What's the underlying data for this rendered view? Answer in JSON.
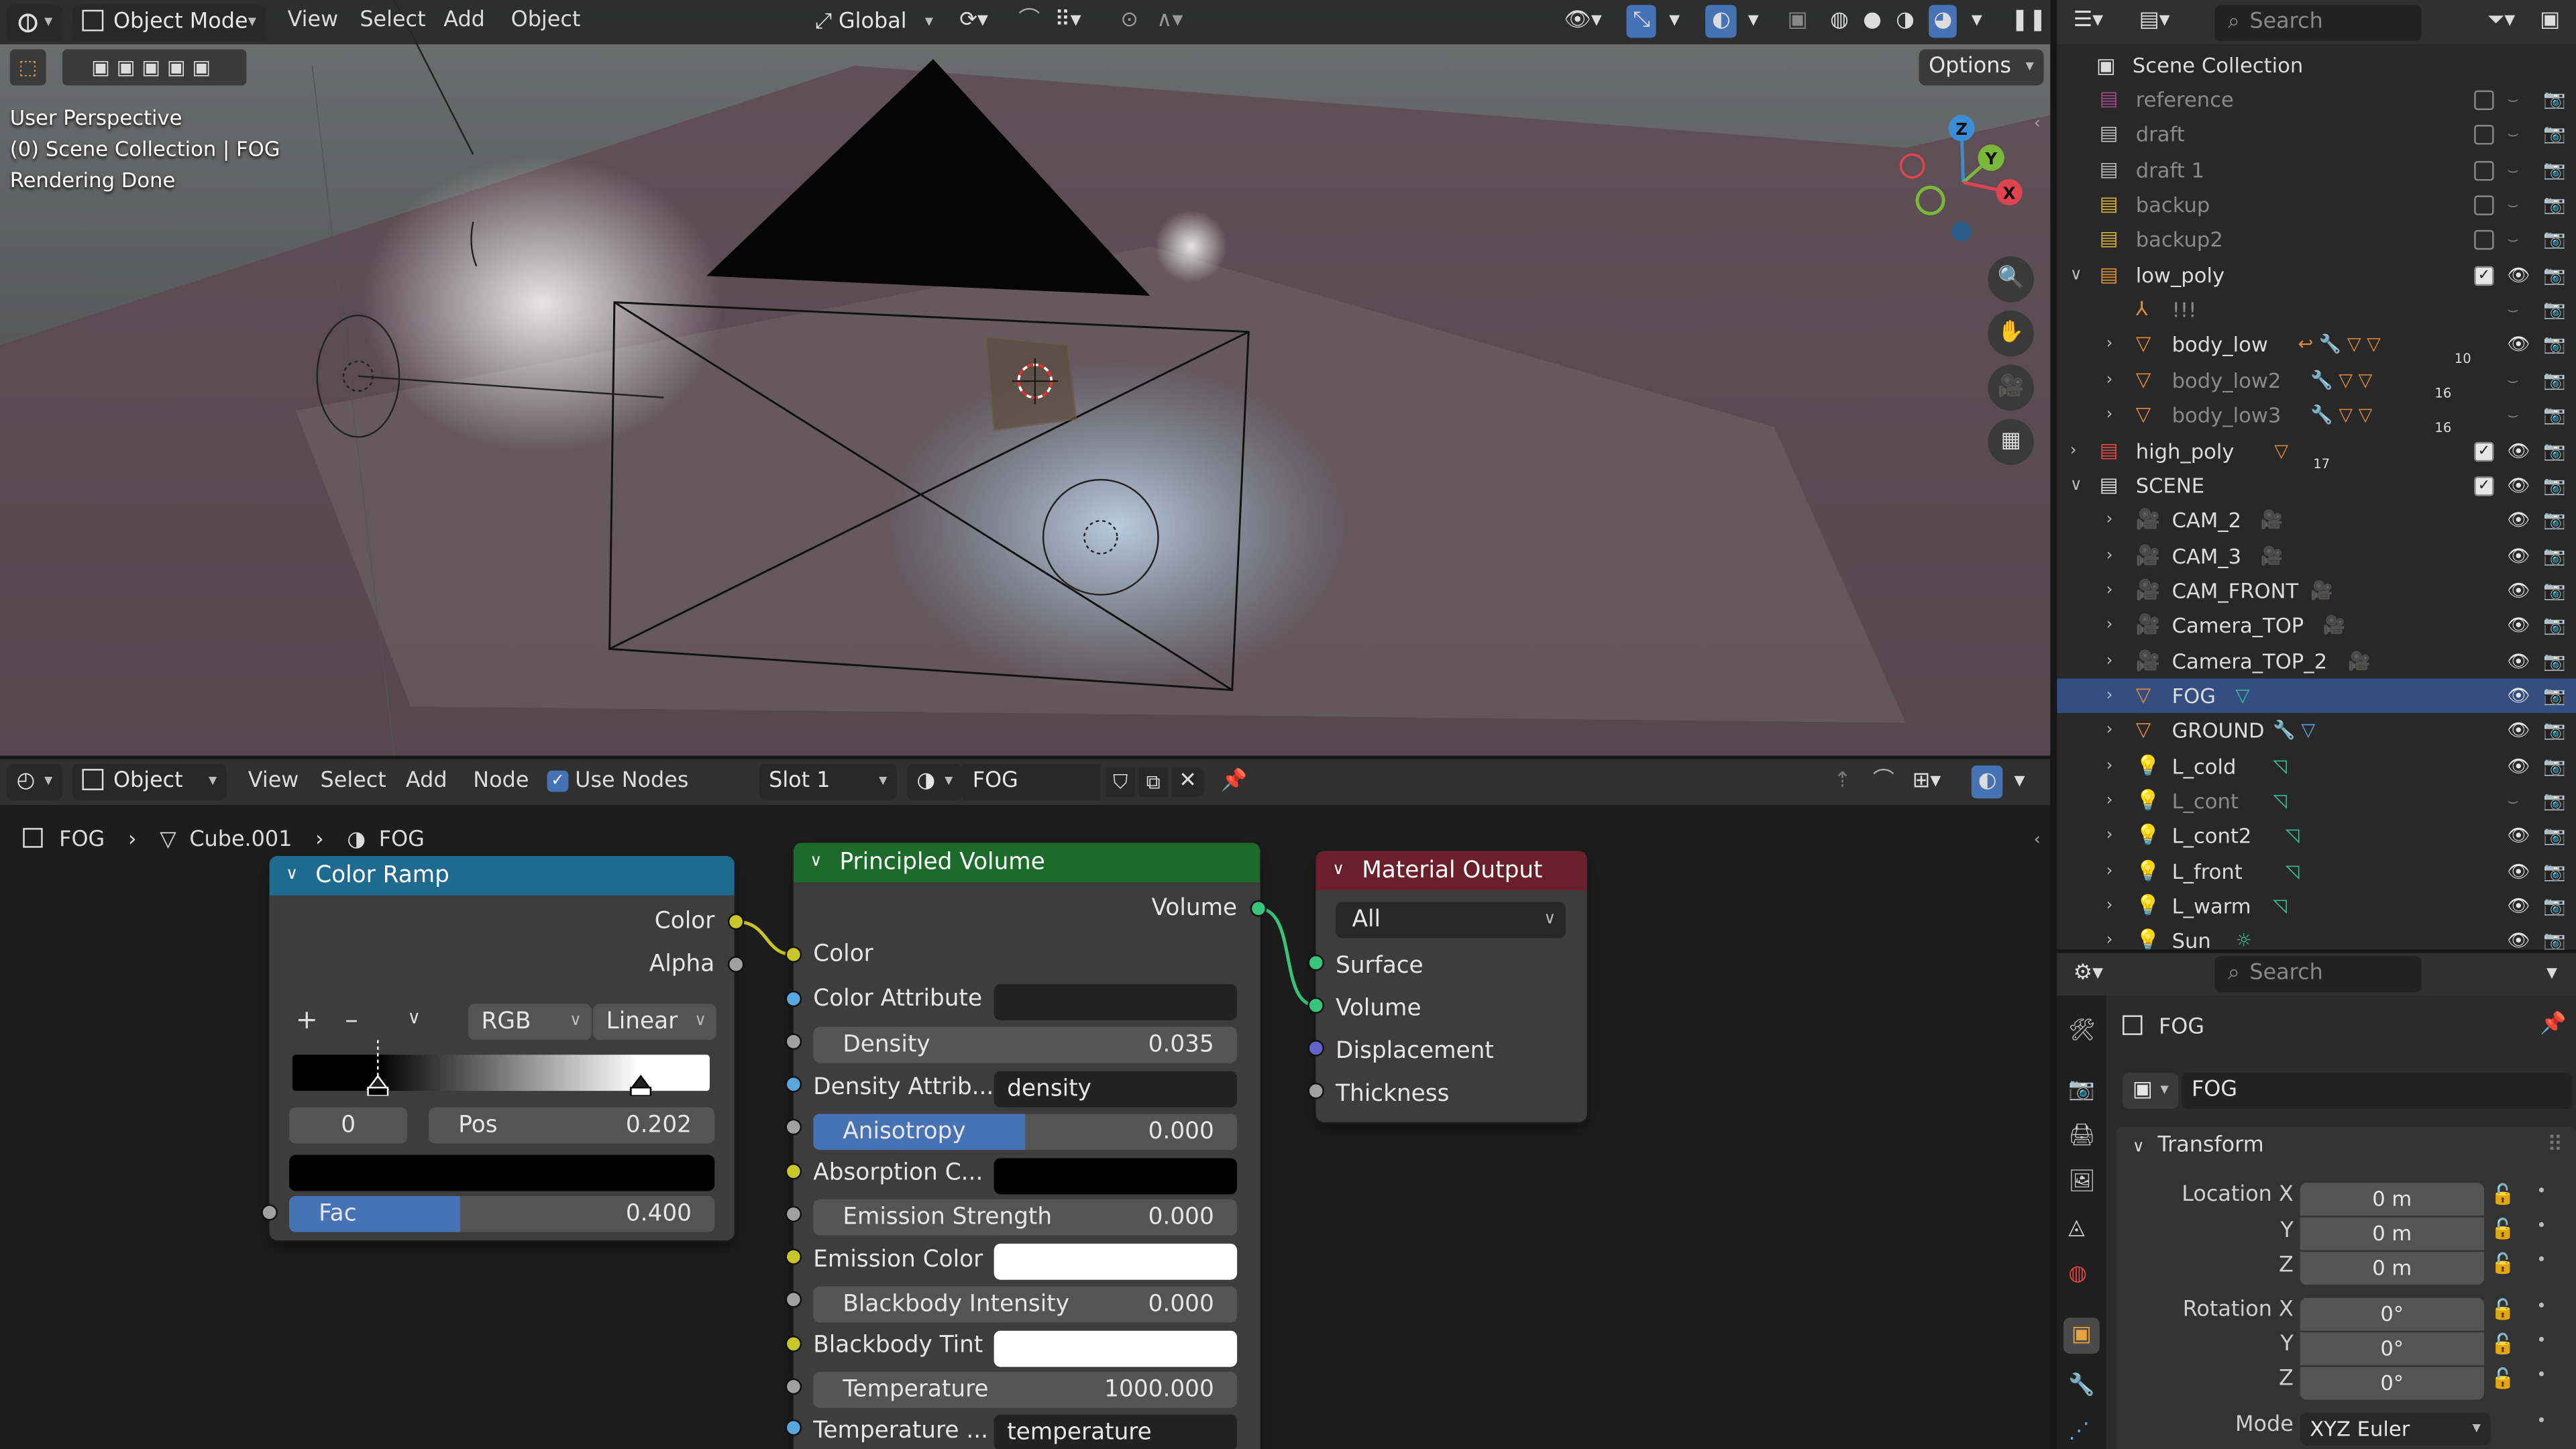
{
  "viewport": {
    "header": {
      "mode": "Object Mode",
      "menus": [
        "View",
        "Select",
        "Add",
        "Object"
      ],
      "transform_orientation": "Global",
      "options": "Options"
    },
    "overlay": {
      "perspective": "User Perspective",
      "collection": "(0) Scene Collection | FOG",
      "status": "Rendering Done"
    },
    "gizmo": {
      "x": "X",
      "y": "Y",
      "z": "Z"
    }
  },
  "node_editor": {
    "header": {
      "type": "Object",
      "menus": [
        "View",
        "Select",
        "Add",
        "Node"
      ],
      "use_nodes": "Use Nodes",
      "slot": "Slot 1",
      "material": "FOG"
    },
    "breadcrumb": {
      "object": "FOG",
      "mesh": "Cube.001",
      "material": "FOG"
    },
    "color_ramp": {
      "title": "Color Ramp",
      "out_color": "Color",
      "out_alpha": "Alpha",
      "add": "+",
      "remove": "–",
      "color_mode": "RGB",
      "interpolation": "Linear",
      "index": "0",
      "pos_label": "Pos",
      "pos_value": "0.202",
      "fac_label": "Fac",
      "fac_value": "0.400",
      "fac_fraction": 0.4
    },
    "principled_volume": {
      "title": "Principled Volume",
      "out_volume": "Volume",
      "color": "Color",
      "color_attribute": "Color Attribute",
      "density_label": "Density",
      "density_value": "0.035",
      "density_attribute_label": "Density Attrib...",
      "density_attribute_value": "density",
      "anisotropy_label": "Anisotropy",
      "anisotropy_value": "0.000",
      "absorption_label": "Absorption C...",
      "emission_strength_label": "Emission Strength",
      "emission_strength_value": "0.000",
      "emission_color_label": "Emission Color",
      "blackbody_intensity_label": "Blackbody Intensity",
      "blackbody_intensity_value": "0.000",
      "blackbody_tint_label": "Blackbody Tint",
      "temperature_label": "Temperature",
      "temperature_value": "1000.000",
      "temperature_attr_label": "Temperature ...",
      "temperature_attr_value": "temperature"
    },
    "material_output": {
      "title": "Material Output",
      "target": "All",
      "surface": "Surface",
      "volume": "Volume",
      "displacement": "Displacement",
      "thickness": "Thickness"
    }
  },
  "outliner": {
    "search_placeholder": "Search",
    "root": "Scene Collection",
    "rows": [
      {
        "name": "reference",
        "dim": true
      },
      {
        "name": "draft",
        "dim": true
      },
      {
        "name": "draft 1",
        "dim": true
      },
      {
        "name": "backup",
        "dim": true
      },
      {
        "name": "backup2",
        "dim": true
      },
      {
        "name": "low_poly",
        "dim": false
      },
      {
        "name": "!!!",
        "dim": true
      },
      {
        "name": "body_low",
        "dim": false
      },
      {
        "name": "body_low2",
        "dim": true
      },
      {
        "name": "body_low3",
        "dim": true
      },
      {
        "name": "high_poly",
        "dim": false
      },
      {
        "name": "SCENE",
        "dim": false
      },
      {
        "name": "CAM_2",
        "dim": false
      },
      {
        "name": "CAM_3",
        "dim": false
      },
      {
        "name": "CAM_FRONT",
        "dim": false
      },
      {
        "name": "Camera_TOP",
        "dim": false
      },
      {
        "name": "Camera_TOP_2",
        "dim": false
      },
      {
        "name": "FOG",
        "dim": false
      },
      {
        "name": "GROUND",
        "dim": false
      },
      {
        "name": "L_cold",
        "dim": false
      },
      {
        "name": "L_cont",
        "dim": true
      },
      {
        "name": "L_cont2",
        "dim": false
      },
      {
        "name": "L_front",
        "dim": false
      },
      {
        "name": "L_warm",
        "dim": false
      },
      {
        "name": "Sun",
        "dim": false
      }
    ],
    "badges": {
      "body_low": "10",
      "body_low2": "16",
      "body_low3": "16",
      "high_poly": "17"
    }
  },
  "properties": {
    "search_placeholder": "Search",
    "object_name": "FOG",
    "data_name": "FOG",
    "panel_title": "Transform",
    "location_label": "Location X",
    "location": [
      "0 m",
      "0 m",
      "0 m"
    ],
    "rotation_label": "Rotation X",
    "rotation": [
      "0°",
      "0°",
      "0°"
    ],
    "axis_y": "Y",
    "axis_z": "Z",
    "mode_label": "Mode",
    "mode_value": "XYZ Euler"
  },
  "colors": {
    "color_ramp_header": "#1f6b8f",
    "principled_header": "#1d6b2a",
    "output_header": "#6b1f2a",
    "selection": "#334d80",
    "accent_blue": "#4772b3"
  }
}
